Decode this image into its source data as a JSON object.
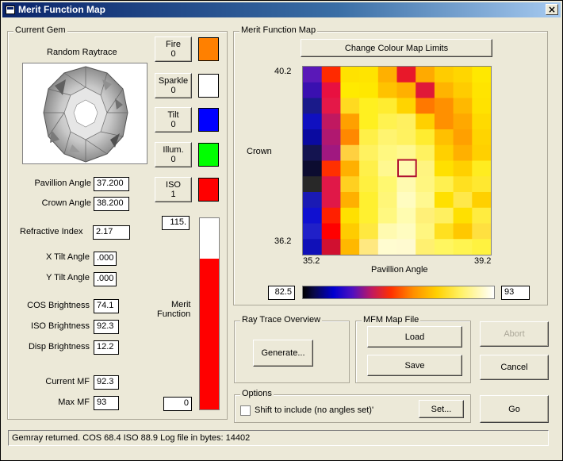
{
  "window": {
    "title": "Merit Function Map",
    "close_label": "×"
  },
  "current_gem": {
    "legend": "Current Gem",
    "raytrace_label": "Random Raytrace",
    "buttons": [
      {
        "name": "fire",
        "line1": "Fire",
        "line2": "0",
        "color": "#ff8000"
      },
      {
        "name": "sparkle",
        "line1": "Sparkle",
        "line2": "0",
        "color": "#ffffff"
      },
      {
        "name": "tilt",
        "line1": "Tilt",
        "line2": "0",
        "color": "#0000ff"
      },
      {
        "name": "illum",
        "line1": "Illum.",
        "line2": "0",
        "color": "#00ff00"
      },
      {
        "name": "iso",
        "line1": "ISO",
        "line2": "1",
        "color": "#ff0000"
      }
    ],
    "pavillion_angle_label": "Pavillion Angle",
    "pavillion_angle": "37.200",
    "crown_angle_label": "Crown Angle",
    "crown_angle": "38.200",
    "refractive_index_label": "Refractive Index",
    "refractive_index": "2.17",
    "x_tilt_label": "X Tilt Angle",
    "x_tilt": ".000",
    "y_tilt_label": "Y Tilt Angle",
    "y_tilt": ".000",
    "cos_brightness_label": "COS Brightness",
    "cos_brightness": "74.1",
    "iso_brightness_label": "ISO Brightness",
    "iso_brightness": "92.3",
    "disp_brightness_label": "Disp Brightness",
    "disp_brightness": "12.2",
    "current_mf_label": "Current MF",
    "current_mf": "92.3",
    "max_mf_label": "Max MF",
    "max_mf": "93",
    "merit_top": "115.",
    "merit_bottom": "0",
    "merit_label_1": "Merit",
    "merit_label_2": "Function",
    "merit_fill_fraction": 0.79
  },
  "mfm": {
    "legend": "Merit Function Map",
    "change_limits_label": "Change Colour Map Limits",
    "y_axis_label": "Crown",
    "y_max": "40.2",
    "y_min": "36.2",
    "x_axis_label": "Pavillion Angle",
    "x_min": "35.2",
    "x_max": "39.2",
    "scale_min": "82.5",
    "scale_max": "93",
    "selected_cell": [
      5,
      6
    ],
    "grid": [
      [
        "#5a18b8",
        "#ff2a00",
        "#ffe200",
        "#ffe400",
        "#ffb000",
        "#e8182a",
        "#ffaa00",
        "#ffcc00",
        "#ffd600",
        "#ffe800"
      ],
      [
        "#3a10b0",
        "#e81040",
        "#ffea00",
        "#ffe800",
        "#ffc200",
        "#ffb000",
        "#e01838",
        "#ffb400",
        "#ffcc00",
        "#ffe400"
      ],
      [
        "#1a1a8a",
        "#e41848",
        "#ffda20",
        "#fff020",
        "#ffec30",
        "#ffd400",
        "#ff7800",
        "#ff9000",
        "#ffb800",
        "#ffe200"
      ],
      [
        "#1010c0",
        "#c01860",
        "#ffa000",
        "#fff020",
        "#fff250",
        "#fff060",
        "#ffd000",
        "#ff9000",
        "#ffa800",
        "#ffda00"
      ],
      [
        "#0a0aa0",
        "#b01870",
        "#ff8800",
        "#fff048",
        "#fff470",
        "#fff260",
        "#ffec30",
        "#ffc000",
        "#ffa000",
        "#ffd400"
      ],
      [
        "#141450",
        "#a01880",
        "#ffd040",
        "#fff260",
        "#fff880",
        "#fff890",
        "#fff260",
        "#ffd000",
        "#ffb000",
        "#ffd000"
      ],
      [
        "#0c0c30",
        "#ff3000",
        "#ffb000",
        "#fff04a",
        "#fff890",
        "#fffab0",
        "#fff480",
        "#ffe000",
        "#ffd000",
        "#ffec20"
      ],
      [
        "#282828",
        "#e01848",
        "#ffd020",
        "#fff040",
        "#fff870",
        "#fffab0",
        "#fff680",
        "#fff050",
        "#ffe020",
        "#ffe830"
      ],
      [
        "#1a1ab4",
        "#e01848",
        "#ffb000",
        "#fff030",
        "#fff678",
        "#fffcc0",
        "#fff890",
        "#ffe000",
        "#ffe84a",
        "#ffd000"
      ],
      [
        "#1010d0",
        "#ff2000",
        "#ffe000",
        "#fff030",
        "#fff880",
        "#fffcb0",
        "#fff078",
        "#fff060",
        "#ffe000",
        "#ffec40"
      ],
      [
        "#2020c8",
        "#ff0000",
        "#ffcc00",
        "#ffe840",
        "#fffab0",
        "#fffcc0",
        "#fff680",
        "#ffe020",
        "#ffc800",
        "#ffe040"
      ],
      [
        "#1010b8",
        "#d01030",
        "#ffb800",
        "#ffe880",
        "#fffcd0",
        "#fffad0",
        "#fff070",
        "#fff660",
        "#fff450",
        "#fff240"
      ]
    ]
  },
  "ray_trace": {
    "legend": "Ray Trace Overview",
    "generate_label": "Generate..."
  },
  "mfm_file": {
    "legend": "MFM Map File",
    "load_label": "Load",
    "save_label": "Save"
  },
  "buttons": {
    "abort_label": "Abort",
    "cancel_label": "Cancel",
    "go_label": "Go"
  },
  "options": {
    "legend": "Options",
    "shift_label": "Shift to include (no angles set)'",
    "set_label": "Set..."
  },
  "status": {
    "text": "Gemray returned.   COS  68.4   ISO  88.9   Log file in bytes:  14402"
  }
}
